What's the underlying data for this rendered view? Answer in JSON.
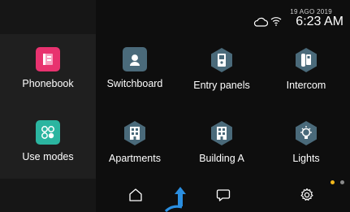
{
  "status": {
    "date": "19 AGO 2019",
    "time": "6:23 AM",
    "cloud_icon": "cloud-icon",
    "wifi_icon": "wifi-icon"
  },
  "colors": {
    "phonebook": "#e8326f",
    "use_modes": "#2bb5a0",
    "hex": "#4a6a7a",
    "accent_dot": "#f2b81c",
    "pointer": "#2a8ee0"
  },
  "tiles": [
    {
      "label": "Phonebook",
      "icon": "phonebook-icon"
    },
    {
      "label": "Switchboard",
      "icon": "concierge-icon"
    },
    {
      "label": "Entry panels",
      "icon": "entry-panel-icon"
    },
    {
      "label": "Intercom",
      "icon": "intercom-handset-icon"
    },
    {
      "label": "Use modes",
      "icon": "use-modes-icon"
    },
    {
      "label": "Apartments",
      "icon": "building-icon"
    },
    {
      "label": "Building A",
      "icon": "building-icon"
    },
    {
      "label": "Lights",
      "icon": "lightbulb-icon"
    }
  ],
  "navbar": {
    "home_icon": "home-icon",
    "messages_icon": "chat-icon",
    "settings_icon": "gear-icon"
  },
  "page_dots": {
    "count": 2,
    "active_index": 0
  }
}
